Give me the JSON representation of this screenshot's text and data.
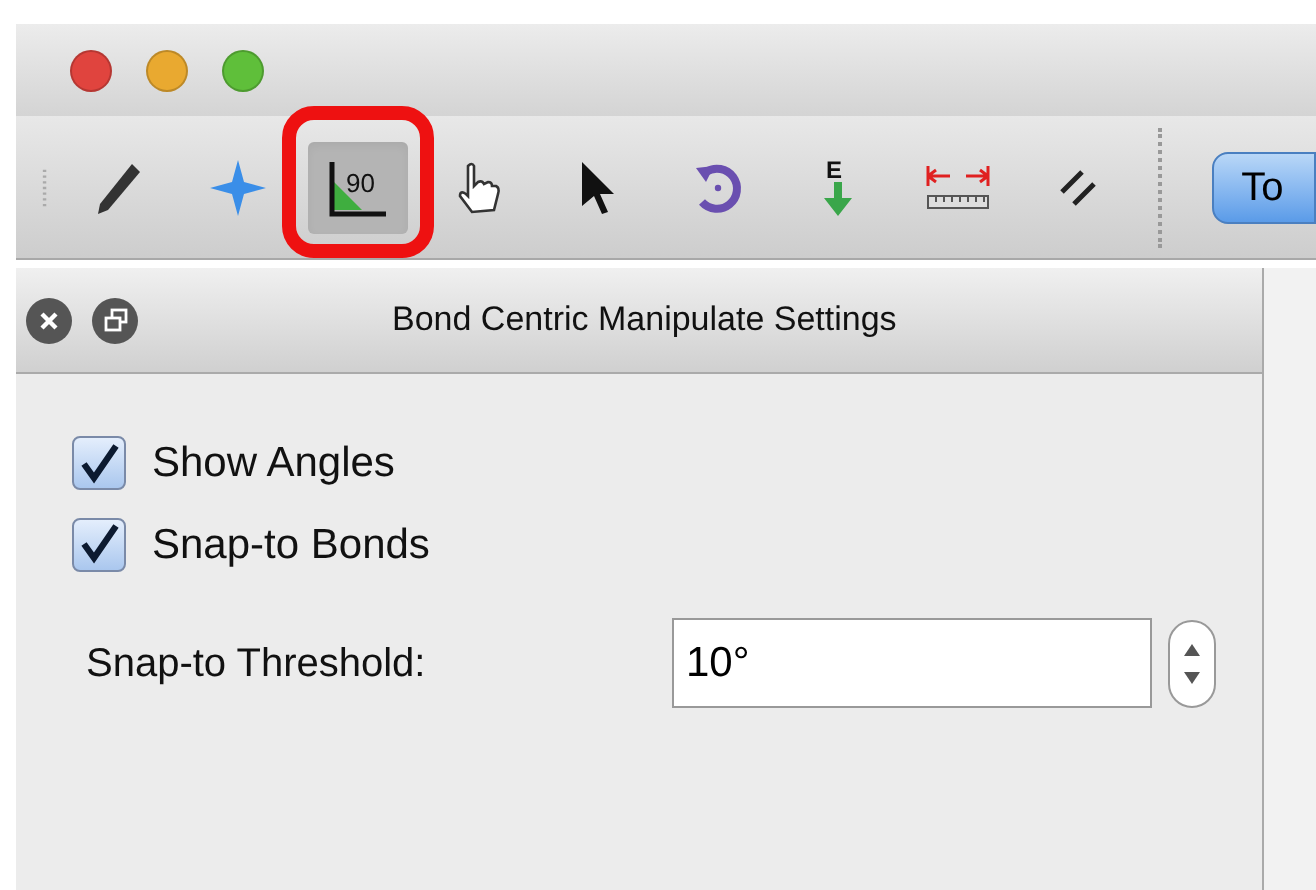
{
  "window": {
    "traffic_lights": [
      {
        "color": "#e0443e"
      },
      {
        "color": "#e9a930"
      },
      {
        "color": "#5fbf3a"
      }
    ]
  },
  "toolbar": {
    "tools": [
      {
        "kind": "pencil",
        "selected": false,
        "highlighted": false
      },
      {
        "kind": "star",
        "selected": false,
        "highlighted": false
      },
      {
        "kind": "angle",
        "label": "90",
        "selected": true,
        "highlighted": true
      },
      {
        "kind": "hand",
        "selected": false,
        "highlighted": false
      },
      {
        "kind": "pointer",
        "selected": false,
        "highlighted": false
      },
      {
        "kind": "rotate",
        "selected": false,
        "highlighted": false
      },
      {
        "kind": "down-arrow",
        "label": "E",
        "selected": false,
        "highlighted": false
      },
      {
        "kind": "ruler",
        "selected": false,
        "highlighted": false
      },
      {
        "kind": "lines",
        "selected": false,
        "highlighted": false
      }
    ],
    "button": {
      "label": "To"
    }
  },
  "panel": {
    "title": "Bond Centric Manipulate Settings",
    "checkboxes": [
      {
        "label": "Show Angles",
        "checked": true
      },
      {
        "label": "Snap-to Bonds",
        "checked": true
      }
    ],
    "threshold": {
      "label": "Snap-to Threshold:",
      "value": "10°"
    }
  }
}
